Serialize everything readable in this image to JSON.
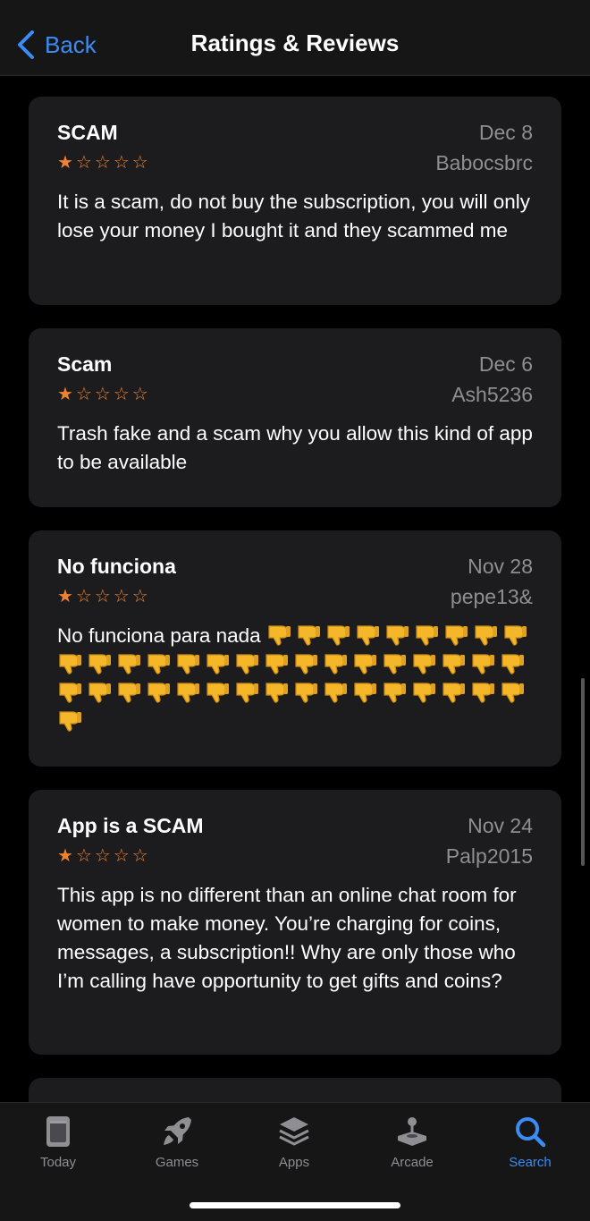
{
  "nav": {
    "back_label": "Back",
    "title": "Ratings & Reviews"
  },
  "reviews": [
    {
      "title": "SCAM",
      "date": "Dec 8",
      "author": "Babocsbrc",
      "rating": 1,
      "body": "It is a scam, do not buy the subscription, you will only lose your money I bought it and they scammed me"
    },
    {
      "title": "Scam",
      "date": "Dec 6",
      "author": "Ash5236",
      "rating": 1,
      "body": "Trash fake and a scam why you allow this kind of app to be available"
    },
    {
      "title": "No funciona",
      "date": "Nov 28",
      "author": "pepe13&",
      "rating": 1,
      "body": "No funciona para nada",
      "thumbs_down_count": 42
    },
    {
      "title": "App is a SCAM",
      "date": "Nov 24",
      "author": "Palp2015",
      "rating": 1,
      "body": "This app is no different than an online chat room for women to make money. You’re charging for coins, messages, a subscription!! Why are only those who I’m calling have opportunity to get gifts and coins?"
    }
  ],
  "tabs": [
    {
      "label": "Today",
      "icon": "today-icon"
    },
    {
      "label": "Games",
      "icon": "rocket-icon"
    },
    {
      "label": "Apps",
      "icon": "layers-icon"
    },
    {
      "label": "Arcade",
      "icon": "joystick-icon"
    },
    {
      "label": "Search",
      "icon": "search-icon",
      "active": true
    }
  ],
  "colors": {
    "accent": "#3b8cf6",
    "star": "#f0822f",
    "card": "#1c1c1e",
    "secondary_text": "#8e8e93"
  }
}
